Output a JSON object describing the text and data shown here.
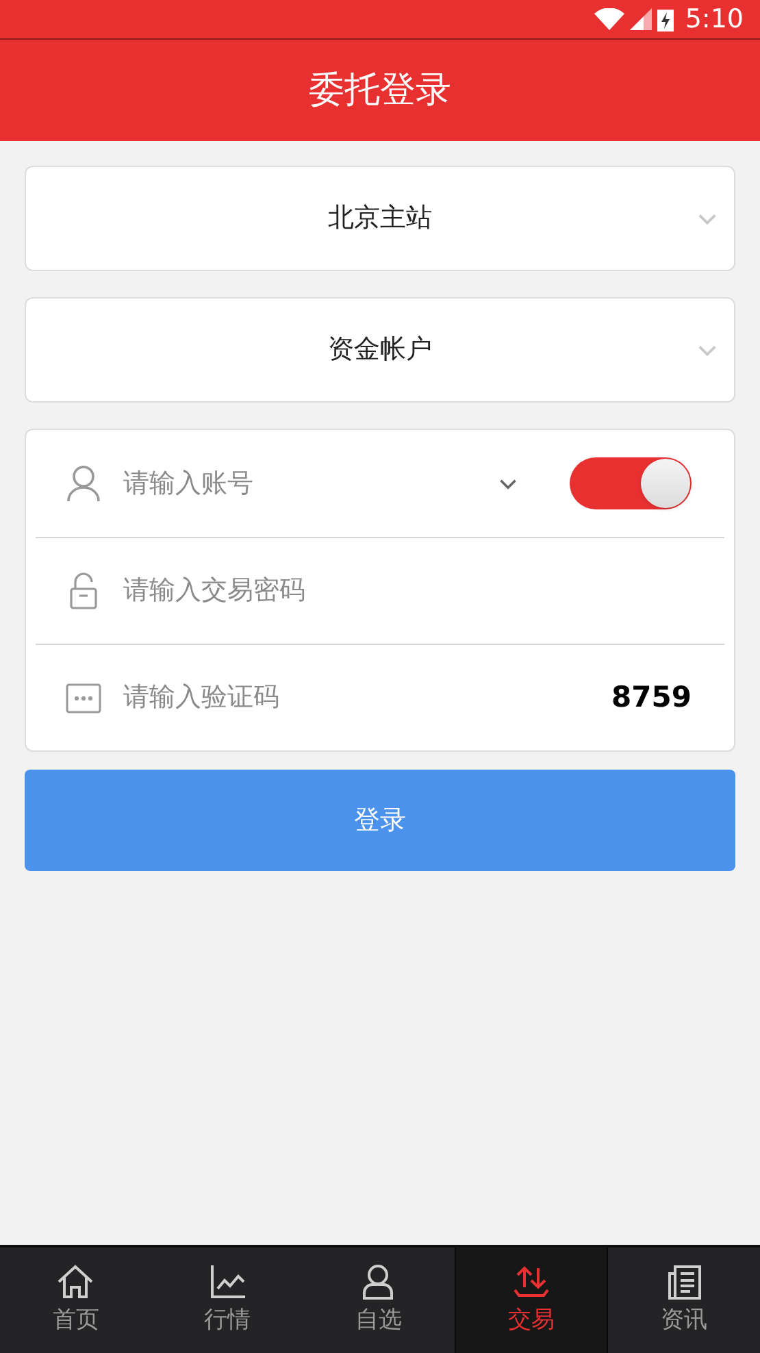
{
  "status_bar": {
    "time": "5:10"
  },
  "header": {
    "title": "委托登录"
  },
  "selects": [
    {
      "value": "北京主站"
    },
    {
      "value": "资金帐户"
    }
  ],
  "form": {
    "fields": [
      {
        "kind": "account",
        "placeholder": "请输入账号"
      },
      {
        "kind": "password",
        "placeholder": "请输入交易密码"
      },
      {
        "kind": "captcha",
        "placeholder": "请输入验证码",
        "code": "8759"
      }
    ],
    "remember_toggle": {
      "on": true
    }
  },
  "login_button": "登录",
  "tabs": [
    {
      "label": "首页",
      "kind": "home",
      "selected": false
    },
    {
      "label": "行情",
      "kind": "chart",
      "selected": false
    },
    {
      "label": "自选",
      "kind": "user",
      "selected": false
    },
    {
      "label": "交易",
      "kind": "trade",
      "selected": true
    },
    {
      "label": "资讯",
      "kind": "news",
      "selected": false
    }
  ]
}
